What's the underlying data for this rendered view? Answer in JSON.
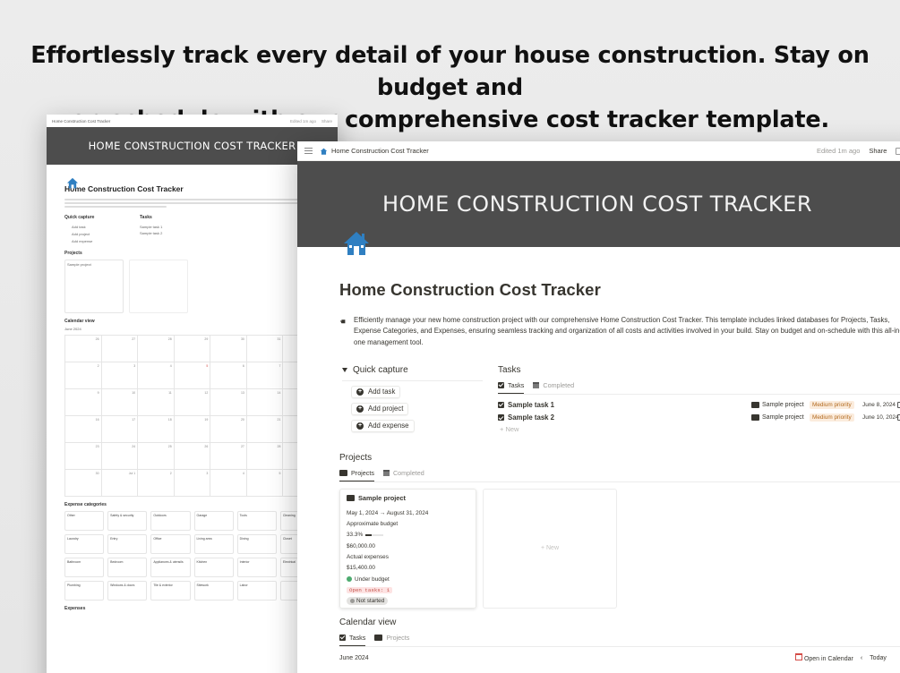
{
  "headline": {
    "line1": "Effortlessly track every detail of your house construction. Stay on budget and",
    "line2": "on schedule with our comprehensive cost tracker template."
  },
  "topbar": {
    "breadcrumb": "Home Construction Cost Tracker",
    "edited": "Edited 1m ago",
    "share": "Share"
  },
  "cover": {
    "title": "HOME CONSTRUCTION COST TRACKER"
  },
  "page": {
    "title": "Home Construction Cost Tracker",
    "description": "Efficiently manage your new home construction project with our comprehensive Home Construction Cost Tracker. This template includes linked databases for Projects, Tasks, Expense Categories, and Expenses, ensuring seamless tracking and organization of all costs and activities involved in your build. Stay on budget and on-schedule with this all-in-one management tool."
  },
  "quick_capture": {
    "title": "Quick capture",
    "buttons": [
      "Add task",
      "Add project",
      "Add expense"
    ]
  },
  "tasks": {
    "title": "Tasks",
    "tabs": [
      "Tasks",
      "Completed"
    ],
    "rows": [
      {
        "name": "Sample task 1",
        "project": "Sample project",
        "priority": "Medium priority",
        "date": "June 8, 2024"
      },
      {
        "name": "Sample task 2",
        "project": "Sample project",
        "priority": "Medium priority",
        "date": "June 10, 2024"
      }
    ],
    "new_label": "New"
  },
  "projects": {
    "title": "Projects",
    "tabs": [
      "Projects",
      "Completed"
    ],
    "card": {
      "name": "Sample project",
      "dates": "May 1, 2024 → August 31, 2024",
      "budget_label": "Approximate budget",
      "budget_pct": "33.3%",
      "budget_progress": 0.333,
      "budget_value": "$60,000.00",
      "actual_label": "Actual expenses",
      "actual_value": "$15,400.00",
      "budget_status": "Under budget",
      "open_tasks": "Open tasks: 1",
      "status": "Not started"
    },
    "new_label": "+ New"
  },
  "calendar": {
    "title": "Calendar view",
    "tabs": [
      "Tasks",
      "Projects"
    ],
    "month": "June 2024",
    "open_in_calendar": "Open in Calendar",
    "today": "Today"
  },
  "back_window": {
    "cover_title": "HOME CONSTRUCTION COST TRACKER",
    "title": "Home Construction Cost Tracker",
    "breadcrumb": "Home Construction Cost Tracker",
    "sections": [
      "Quick capture",
      "Tasks",
      "Projects",
      "Calendar view",
      "Expense categories",
      "Expenses"
    ],
    "categories": [
      "Other",
      "Safety & security",
      "Outdoors",
      "Garage",
      "Tools",
      "Cleaning",
      "Laundry",
      "Entry",
      "Office",
      "Living area",
      "Dining",
      "Closet",
      "Bathroom",
      "Bedroom",
      "Appliances & utensils",
      "Kitchen",
      "Interior",
      "Electrical",
      "Plumbing",
      "Windows & doors",
      "Tile & exterior",
      "Sitework",
      "Labor"
    ]
  },
  "colors": {
    "cover": "#4d4d4d",
    "icon_blue": "#2f7fc1",
    "priority_bg": "#fbecdd",
    "priority_fg": "#b26a1f",
    "under_budget": "#4dab6f"
  }
}
